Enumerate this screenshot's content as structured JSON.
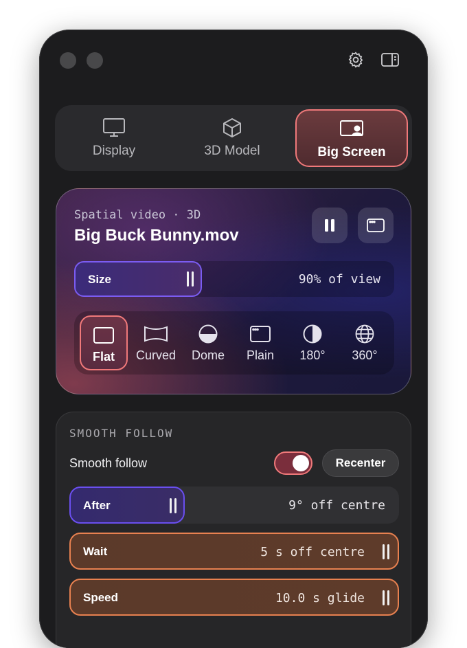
{
  "tabs": [
    {
      "label": "Display",
      "icon": "monitor-icon",
      "active": false
    },
    {
      "label": "3D Model",
      "icon": "cube-icon",
      "active": false
    },
    {
      "label": "Big Screen",
      "icon": "big-screen-icon",
      "active": true
    }
  ],
  "player": {
    "subtitle": "Spatial video · 3D",
    "title": "Big Buck Bunny.mov",
    "pause_icon": "pause-icon",
    "window_icon": "window-icon",
    "size": {
      "label": "Size",
      "value": "90% of view"
    },
    "modes": [
      {
        "label": "Flat",
        "icon": "flat-screen-icon",
        "active": true
      },
      {
        "label": "Curved",
        "icon": "curved-screen-icon",
        "active": false
      },
      {
        "label": "Dome",
        "icon": "dome-icon",
        "active": false
      },
      {
        "label": "Plain",
        "icon": "plain-window-icon",
        "active": false
      },
      {
        "label": "180°",
        "icon": "half-circle-icon",
        "active": false
      },
      {
        "label": "360°",
        "icon": "globe-icon",
        "active": false
      }
    ]
  },
  "smooth_follow": {
    "heading": "SMOOTH FOLLOW",
    "toggle_label": "Smooth follow",
    "toggle_on": true,
    "recenter_label": "Recenter",
    "after": {
      "label": "After",
      "value": "9° off centre"
    },
    "wait": {
      "label": "Wait",
      "value": "5 s off centre"
    },
    "speed": {
      "label": "Speed",
      "value": "10.0 s glide"
    }
  },
  "colors": {
    "accent_active": "#f0797a",
    "slider_purple": "#7b5cf2",
    "slider_orange": "#e88150",
    "window_bg": "#1c1c1e"
  }
}
